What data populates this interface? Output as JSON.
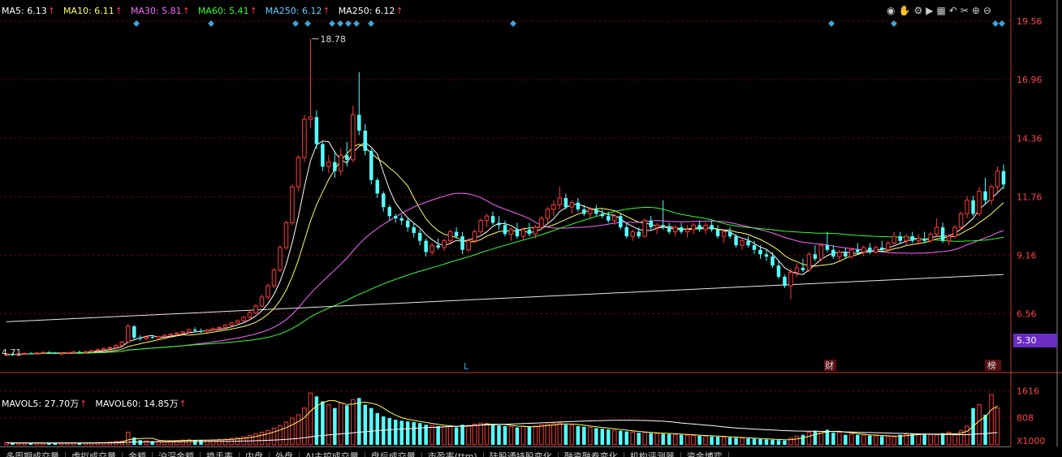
{
  "legend": {
    "items": [
      {
        "label": "MA5: 6.13",
        "color": "#ffffff"
      },
      {
        "label": "MA10: 6.11",
        "color": "#ffff66"
      },
      {
        "label": "MA30: 5.81",
        "color": "#ff66ff"
      },
      {
        "label": "MA60: 5.41",
        "color": "#33ff33"
      },
      {
        "label": "MA250: 6.12",
        "color": "#66ccff"
      },
      {
        "label": "MA250: 6.12",
        "color": "#ffffff"
      }
    ],
    "arrow": "↑"
  },
  "vol_legend": {
    "items": [
      {
        "label": "MAVOL5: 27.70万",
        "color": "#ffffff"
      },
      {
        "label": "MAVOL60: 14.85万",
        "color": "#ffffff"
      }
    ],
    "arrow": "↑"
  },
  "last_price": "5.30",
  "price_labels": [
    "19.56",
    "16.96",
    "14.36",
    "11.76",
    "9.16",
    "6.56"
  ],
  "volume_labels": [
    "1616",
    "808",
    "X1000"
  ],
  "annotations": {
    "high": "18.78",
    "low": "4.71",
    "marker_l": "L",
    "marker_cai": "财",
    "marker_bang": "榜"
  },
  "toolbar_icons": [
    "eye-icon",
    "hand-icon",
    "settings-icon",
    "play-icon",
    "grid-icon",
    "undo-icon",
    "cut-icon",
    "zoom-in-icon",
    "zoom-out-icon"
  ],
  "tabs": [
    "多周期成交量",
    "虚拟成交量",
    "金额",
    "沪深金额",
    "换手率",
    "内盘",
    "外盘",
    "AI主控成交量",
    "盘后成交量",
    "市盈率(ttm)",
    "陆股通持股变化",
    "融资融券变化",
    "机构评测器",
    "资金博弈"
  ],
  "colors": {
    "up": "#ff3b3b",
    "down": "#54ffff",
    "grid": "#8b0000",
    "axis": "#c0392b"
  },
  "chart_data": [
    {
      "type": "candlestick",
      "yrange": [
        4.7,
        20.0
      ],
      "yticks": [
        19.56,
        16.96,
        14.36,
        11.76,
        9.16,
        6.56
      ],
      "ohlc": [
        [
          4.72,
          4.8,
          4.68,
          4.76
        ],
        [
          4.76,
          4.82,
          4.7,
          4.73
        ],
        [
          4.73,
          4.8,
          4.69,
          4.78
        ],
        [
          4.78,
          4.84,
          4.74,
          4.8
        ],
        [
          4.8,
          4.86,
          4.76,
          4.79
        ],
        [
          4.79,
          4.85,
          4.74,
          4.82
        ],
        [
          4.82,
          4.88,
          4.78,
          4.84
        ],
        [
          4.84,
          4.9,
          4.8,
          4.82
        ],
        [
          4.82,
          4.86,
          4.77,
          4.79
        ],
        [
          4.79,
          4.84,
          4.74,
          4.8
        ],
        [
          4.8,
          4.86,
          4.76,
          4.83
        ],
        [
          4.83,
          4.9,
          4.79,
          4.86
        ],
        [
          4.86,
          4.92,
          4.82,
          4.84
        ],
        [
          4.84,
          4.9,
          4.8,
          4.87
        ],
        [
          4.87,
          4.95,
          4.83,
          4.92
        ],
        [
          4.92,
          5.0,
          4.88,
          4.96
        ],
        [
          4.96,
          5.05,
          4.92,
          5.02
        ],
        [
          5.02,
          5.1,
          4.98,
          5.06
        ],
        [
          5.06,
          5.2,
          5.0,
          5.15
        ],
        [
          5.15,
          5.35,
          5.1,
          5.3
        ],
        [
          5.3,
          6.1,
          5.25,
          6.0
        ],
        [
          6.0,
          6.05,
          5.4,
          5.5
        ],
        [
          5.5,
          5.6,
          5.35,
          5.45
        ],
        [
          5.45,
          5.55,
          5.38,
          5.52
        ],
        [
          5.52,
          5.6,
          5.45,
          5.48
        ],
        [
          5.48,
          5.58,
          5.42,
          5.55
        ],
        [
          5.55,
          5.65,
          5.5,
          5.6
        ],
        [
          5.6,
          5.7,
          5.52,
          5.65
        ],
        [
          5.65,
          5.75,
          5.58,
          5.7
        ],
        [
          5.7,
          5.8,
          5.62,
          5.75
        ],
        [
          5.75,
          5.9,
          5.7,
          5.85
        ],
        [
          5.85,
          5.95,
          5.75,
          5.8
        ],
        [
          5.8,
          5.9,
          5.7,
          5.78
        ],
        [
          5.78,
          5.88,
          5.72,
          5.84
        ],
        [
          5.84,
          5.95,
          5.78,
          5.9
        ],
        [
          5.9,
          6.0,
          5.82,
          5.95
        ],
        [
          5.95,
          6.1,
          5.9,
          6.05
        ],
        [
          6.05,
          6.2,
          6.0,
          6.15
        ],
        [
          6.15,
          6.3,
          6.1,
          6.25
        ],
        [
          6.25,
          6.45,
          6.2,
          6.4
        ],
        [
          6.4,
          6.7,
          6.35,
          6.6
        ],
        [
          6.6,
          7.0,
          6.55,
          6.9
        ],
        [
          6.9,
          7.4,
          6.85,
          7.3
        ],
        [
          7.3,
          7.9,
          7.2,
          7.8
        ],
        [
          7.8,
          8.6,
          7.7,
          8.5
        ],
        [
          8.5,
          9.6,
          8.4,
          9.5
        ],
        [
          9.5,
          10.7,
          9.4,
          10.6
        ],
        [
          10.6,
          12.3,
          10.5,
          12.2
        ],
        [
          12.2,
          13.6,
          12.0,
          13.5
        ],
        [
          13.5,
          15.4,
          13.3,
          15.2
        ],
        [
          15.2,
          18.78,
          14.8,
          15.3
        ],
        [
          15.3,
          15.6,
          13.9,
          14.1
        ],
        [
          14.1,
          14.2,
          12.9,
          13.1
        ],
        [
          13.1,
          13.6,
          12.8,
          13.3
        ],
        [
          13.3,
          13.8,
          12.6,
          12.9
        ],
        [
          12.9,
          13.9,
          12.7,
          13.6
        ],
        [
          13.6,
          14.2,
          13.1,
          13.4
        ],
        [
          13.4,
          15.8,
          13.3,
          15.4
        ],
        [
          15.4,
          17.3,
          14.5,
          14.7
        ],
        [
          14.7,
          15.0,
          13.6,
          13.8
        ],
        [
          13.8,
          13.9,
          12.3,
          12.5
        ],
        [
          12.5,
          12.6,
          11.7,
          11.9
        ],
        [
          11.9,
          12.0,
          11.1,
          11.3
        ],
        [
          11.3,
          11.4,
          10.7,
          10.9
        ],
        [
          10.9,
          11.0,
          10.6,
          10.8
        ],
        [
          10.8,
          10.95,
          10.5,
          10.7
        ],
        [
          10.7,
          10.8,
          10.2,
          10.4
        ],
        [
          10.4,
          10.6,
          9.95,
          10.15
        ],
        [
          10.15,
          10.3,
          9.6,
          9.8
        ],
        [
          9.8,
          9.9,
          9.1,
          9.3
        ],
        [
          9.3,
          9.7,
          9.15,
          9.6
        ],
        [
          9.6,
          9.9,
          9.4,
          9.5
        ],
        [
          9.5,
          9.9,
          9.35,
          9.8
        ],
        [
          9.8,
          10.3,
          9.7,
          10.2
        ],
        [
          10.2,
          10.4,
          9.9,
          10.0
        ],
        [
          10.0,
          10.2,
          9.2,
          9.4
        ],
        [
          9.4,
          9.9,
          9.3,
          9.8
        ],
        [
          9.8,
          10.3,
          9.7,
          10.2
        ],
        [
          10.2,
          10.8,
          10.1,
          10.7
        ],
        [
          10.7,
          11.0,
          10.4,
          10.9
        ],
        [
          10.9,
          11.1,
          10.5,
          10.6
        ],
        [
          10.6,
          10.9,
          10.3,
          10.5
        ],
        [
          10.5,
          10.7,
          10.0,
          10.1
        ],
        [
          10.1,
          10.4,
          9.8,
          10.3
        ],
        [
          10.3,
          10.6,
          9.9,
          10.0
        ],
        [
          10.0,
          10.4,
          9.8,
          10.3
        ],
        [
          10.3,
          10.6,
          10.0,
          10.1
        ],
        [
          10.1,
          10.5,
          9.9,
          10.4
        ],
        [
          10.4,
          10.9,
          10.3,
          10.8
        ],
        [
          10.8,
          11.3,
          10.6,
          11.2
        ],
        [
          11.2,
          11.6,
          10.9,
          11.4
        ],
        [
          11.4,
          12.2,
          11.2,
          11.7
        ],
        [
          11.7,
          11.9,
          11.2,
          11.3
        ],
        [
          11.3,
          11.6,
          11.0,
          11.5
        ],
        [
          11.5,
          11.7,
          11.1,
          11.2
        ],
        [
          11.2,
          11.4,
          10.9,
          11.0
        ],
        [
          11.0,
          11.3,
          10.8,
          11.2
        ],
        [
          11.2,
          11.4,
          10.9,
          11.0
        ],
        [
          11.0,
          11.2,
          10.8,
          10.9
        ],
        [
          10.9,
          11.1,
          10.6,
          10.7
        ],
        [
          10.7,
          11.0,
          10.5,
          10.9
        ],
        [
          10.9,
          11.0,
          10.3,
          10.4
        ],
        [
          10.4,
          10.6,
          9.9,
          10.0
        ],
        [
          10.0,
          10.3,
          9.8,
          10.2
        ],
        [
          10.2,
          10.4,
          9.9,
          10.0
        ],
        [
          10.0,
          10.8,
          9.95,
          10.7
        ],
        [
          10.7,
          10.9,
          10.3,
          10.4
        ],
        [
          10.4,
          10.6,
          10.1,
          10.5
        ],
        [
          10.5,
          11.6,
          10.3,
          10.4
        ],
        [
          10.4,
          10.6,
          10.1,
          10.2
        ],
        [
          10.2,
          10.5,
          10.0,
          10.4
        ],
        [
          10.4,
          10.6,
          10.1,
          10.2
        ],
        [
          10.2,
          10.5,
          9.95,
          10.3
        ],
        [
          10.3,
          10.6,
          10.1,
          10.5
        ],
        [
          10.5,
          10.7,
          10.2,
          10.3
        ],
        [
          10.3,
          10.6,
          10.1,
          10.5
        ],
        [
          10.5,
          10.7,
          10.2,
          10.3
        ],
        [
          10.3,
          10.5,
          9.9,
          10.0
        ],
        [
          10.0,
          10.3,
          9.7,
          10.2
        ],
        [
          10.2,
          10.4,
          9.9,
          10.0
        ],
        [
          10.0,
          10.1,
          9.5,
          9.6
        ],
        [
          9.6,
          9.9,
          9.4,
          9.8
        ],
        [
          9.8,
          10.0,
          9.5,
          9.6
        ],
        [
          9.6,
          9.8,
          9.2,
          9.4
        ],
        [
          9.4,
          9.6,
          9.0,
          9.2
        ],
        [
          9.2,
          9.4,
          8.9,
          9.1
        ],
        [
          9.1,
          9.3,
          8.6,
          8.7
        ],
        [
          8.7,
          8.9,
          8.1,
          8.2
        ],
        [
          8.2,
          8.3,
          7.7,
          7.8
        ],
        [
          7.8,
          8.6,
          7.2,
          8.4
        ],
        [
          8.4,
          8.8,
          8.2,
          8.6
        ],
        [
          8.6,
          9.0,
          8.4,
          8.5
        ],
        [
          8.5,
          9.3,
          8.4,
          9.2
        ],
        [
          9.2,
          9.6,
          8.9,
          9.0
        ],
        [
          9.0,
          9.7,
          8.9,
          9.6
        ],
        [
          9.6,
          10.2,
          9.3,
          9.4
        ],
        [
          9.4,
          9.6,
          9.0,
          9.1
        ],
        [
          9.1,
          9.4,
          8.9,
          9.3
        ],
        [
          9.3,
          9.5,
          9.0,
          9.1
        ],
        [
          9.1,
          9.5,
          9.0,
          9.4
        ],
        [
          9.4,
          9.7,
          9.2,
          9.3
        ],
        [
          9.3,
          9.6,
          9.1,
          9.5
        ],
        [
          9.5,
          9.7,
          9.2,
          9.3
        ],
        [
          9.3,
          9.6,
          9.2,
          9.5
        ],
        [
          9.5,
          9.8,
          9.3,
          9.4
        ],
        [
          9.4,
          9.8,
          9.3,
          9.7
        ],
        [
          9.7,
          10.2,
          9.6,
          10.0
        ],
        [
          10.0,
          10.2,
          9.7,
          9.8
        ],
        [
          9.8,
          10.1,
          9.6,
          10.0
        ],
        [
          10.0,
          10.2,
          9.7,
          9.8
        ],
        [
          9.8,
          10.1,
          9.6,
          9.9
        ],
        [
          9.9,
          10.2,
          9.7,
          9.8
        ],
        [
          9.8,
          10.2,
          9.7,
          10.1
        ],
        [
          10.1,
          10.8,
          10.0,
          10.4
        ],
        [
          10.4,
          10.6,
          9.7,
          9.8
        ],
        [
          9.8,
          10.1,
          9.6,
          10.0
        ],
        [
          10.0,
          10.5,
          9.9,
          10.4
        ],
        [
          10.4,
          11.1,
          10.3,
          11.0
        ],
        [
          11.0,
          11.8,
          10.8,
          11.6
        ],
        [
          11.6,
          11.8,
          10.9,
          11.0
        ],
        [
          11.0,
          12.2,
          10.9,
          12.0
        ],
        [
          12.0,
          12.6,
          11.4,
          11.6
        ],
        [
          11.6,
          12.3,
          11.4,
          12.2
        ],
        [
          12.2,
          13.1,
          12.0,
          12.9
        ],
        [
          12.9,
          13.2,
          12.1,
          12.3
        ]
      ]
    },
    {
      "type": "bar",
      "yrange": [
        0,
        1700
      ],
      "yticks": [
        1616,
        808
      ],
      "values": [
        60,
        55,
        50,
        58,
        52,
        60,
        55,
        50,
        48,
        55,
        60,
        62,
        58,
        55,
        60,
        65,
        70,
        80,
        95,
        110,
        380,
        220,
        140,
        120,
        110,
        115,
        120,
        125,
        130,
        140,
        150,
        140,
        135,
        140,
        150,
        160,
        170,
        190,
        210,
        240,
        280,
        330,
        380,
        430,
        500,
        580,
        680,
        800,
        900,
        1100,
        1550,
        1450,
        1300,
        1200,
        1100,
        1250,
        1180,
        1350,
        1400,
        1200,
        1100,
        950,
        850,
        800,
        750,
        720,
        700,
        680,
        650,
        600,
        580,
        560,
        540,
        560,
        520,
        600,
        580,
        620,
        650,
        640,
        600,
        580,
        560,
        540,
        520,
        560,
        540,
        560,
        600,
        620,
        640,
        660,
        600,
        580,
        560,
        540,
        520,
        500,
        480,
        460,
        440,
        420,
        400,
        380,
        360,
        370,
        350,
        340,
        330,
        320,
        310,
        300,
        290,
        280,
        270,
        260,
        250,
        240,
        230,
        220,
        210,
        200,
        190,
        180,
        170,
        160,
        150,
        140,
        130,
        200,
        260,
        300,
        380,
        420,
        400,
        450,
        360,
        380,
        300,
        320,
        300,
        290,
        280,
        270,
        260,
        250,
        240,
        300,
        320,
        340,
        330,
        320,
        310,
        300,
        350,
        380,
        300,
        420,
        560,
        1100,
        1200,
        900,
        1500,
        1100
      ]
    }
  ]
}
